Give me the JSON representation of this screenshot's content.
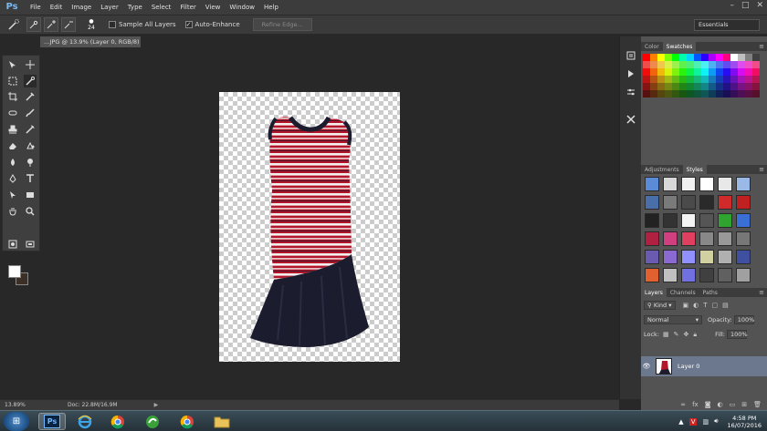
{
  "app": {
    "logo": "Ps"
  },
  "menu": [
    "File",
    "Edit",
    "Image",
    "Layer",
    "Type",
    "Select",
    "Filter",
    "View",
    "Window",
    "Help"
  ],
  "window_controls": [
    "–",
    "□",
    "✕"
  ],
  "options_bar": {
    "brush_size": "24",
    "sample_all_layers": "Sample All Layers",
    "auto_enhance": "Auto-Enhance",
    "refine_edge": "Refine Edge...",
    "workspace": "Essentials"
  },
  "document_tab": {
    "title": "…JPG @ 13.9% (Layer 0, RGB/8) *",
    "close": "×"
  },
  "status_bar": {
    "zoom": "13.89%",
    "doc": "Doc: 22.8M/16.9M"
  },
  "panels": {
    "color_tab": "Color",
    "swatches_tab": "Swatches",
    "adjustments_tab": "Adjustments",
    "styles_tab": "Styles",
    "layers_tab": "Layers",
    "channels_tab": "Channels",
    "paths_tab": "Paths",
    "kind": "Kind",
    "blend_mode": "Normal",
    "opacity_label": "Opacity:",
    "opacity_value": "100%",
    "lock_label": "Lock:",
    "fill_label": "Fill:",
    "fill_value": "100%",
    "layer_name": "Layer 0"
  },
  "taskbar": {
    "time": "4:58 PM",
    "date": "16/07/2016"
  },
  "colors": {
    "stripe_red": "#b3162a",
    "skirt_navy": "#1b1c2e",
    "selection_blue": "#6b788e"
  }
}
